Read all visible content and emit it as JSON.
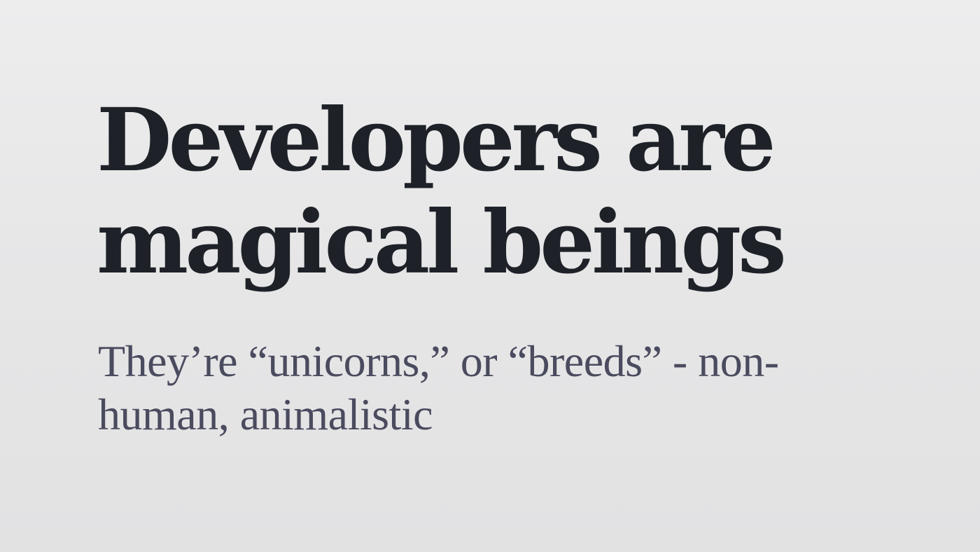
{
  "slide": {
    "title_lines": [
      "Developers are",
      "magical beings"
    ],
    "subtitle_lines": [
      "They’re “unicorns,” or “breeds” - non-",
      "human, animalistic"
    ]
  },
  "colors": {
    "title": "#1e2228",
    "subtitle": "#4a4b5e",
    "background": "#e6e6e7"
  }
}
